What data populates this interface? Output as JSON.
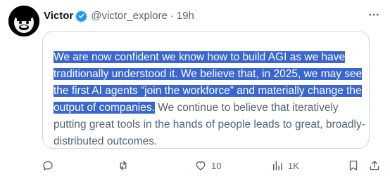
{
  "post": {
    "author_name": "Victor",
    "handle": "@victor_explore",
    "separator": "·",
    "time": "19h"
  },
  "quote": {
    "highlighted": "We are now confident we know how to build AGI as we have traditionally understood it. We believe that, in 2025, we may see the first AI agents “join the workforce” and materially change the output of companies.",
    "rest": " We continue to believe that iteratively putting great tools in the hands of people leads to great, broadly-distributed outcomes."
  },
  "actions": {
    "likes": "10",
    "views": "1K"
  },
  "icons": {
    "avatar": "gorilla-avatar",
    "verified": "verified-badge-icon",
    "more": "more-icon",
    "reply": "reply-icon",
    "repost": "repost-icon",
    "like": "heart-icon",
    "views": "views-icon",
    "bookmark": "bookmark-icon",
    "share": "share-icon"
  },
  "colors": {
    "verified": "#1d9bf0",
    "highlight": "#3a66d0",
    "muted": "#536471",
    "text": "#0f1419",
    "border": "#cfd9de"
  }
}
